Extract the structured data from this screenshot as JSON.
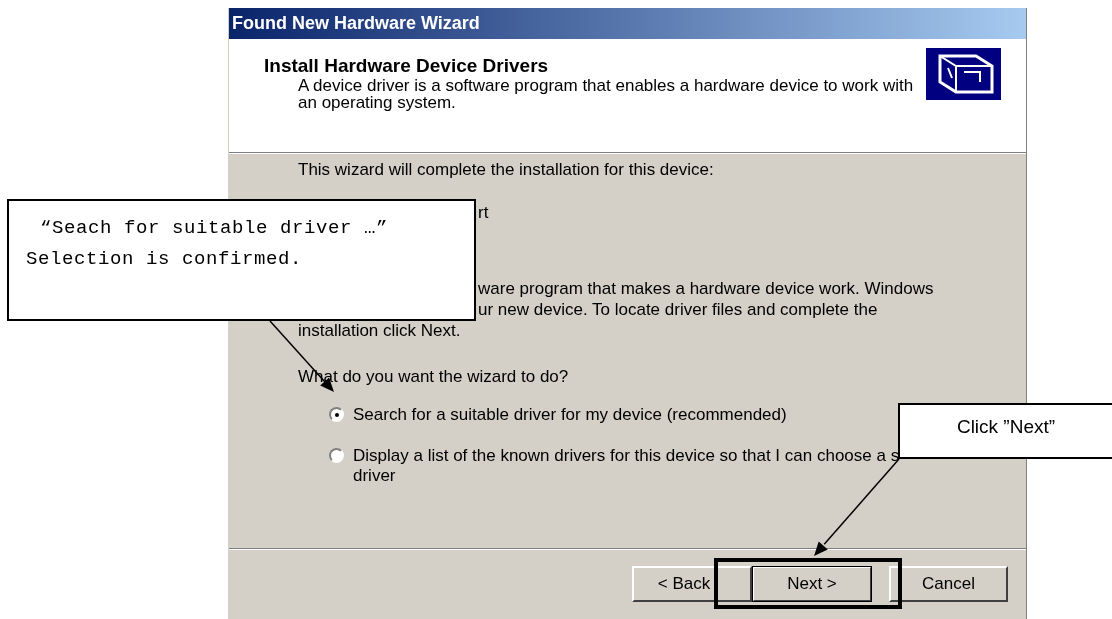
{
  "window": {
    "title": "Found New Hardware Wizard"
  },
  "header": {
    "heading": "Install Hardware Device Drivers",
    "description": "A device driver is a software program that enables a hardware device to work with an operating system."
  },
  "intro": "This wizard will complete the installation for this device:",
  "device": {
    "name": "rt"
  },
  "explanation_lines": [
    "ware program that makes a hardware device work. Windows",
    "ur new device. To locate driver files and complete the",
    "installation click Next."
  ],
  "question": "What do you want the wizard to do?",
  "options": [
    {
      "lines": [
        "Search for a suitable driver for my device (recommended)"
      ],
      "selected": true
    },
    {
      "lines": [
        "Display a list of the known drivers for this device so that I can choose a s",
        "driver"
      ],
      "selected": false
    }
  ],
  "buttons": [
    {
      "label": "< Back",
      "kind": "back"
    },
    {
      "label": "Next >",
      "kind": "default"
    },
    {
      "label": "Cancel",
      "kind": "normal"
    }
  ],
  "callouts": [
    {
      "kind": "mono",
      "lines": [
        "“Seach for suitable driver …”",
        "Selection is confirmed."
      ]
    },
    {
      "kind": "sans",
      "lines": [
        "Click ”Next”"
      ]
    }
  ]
}
